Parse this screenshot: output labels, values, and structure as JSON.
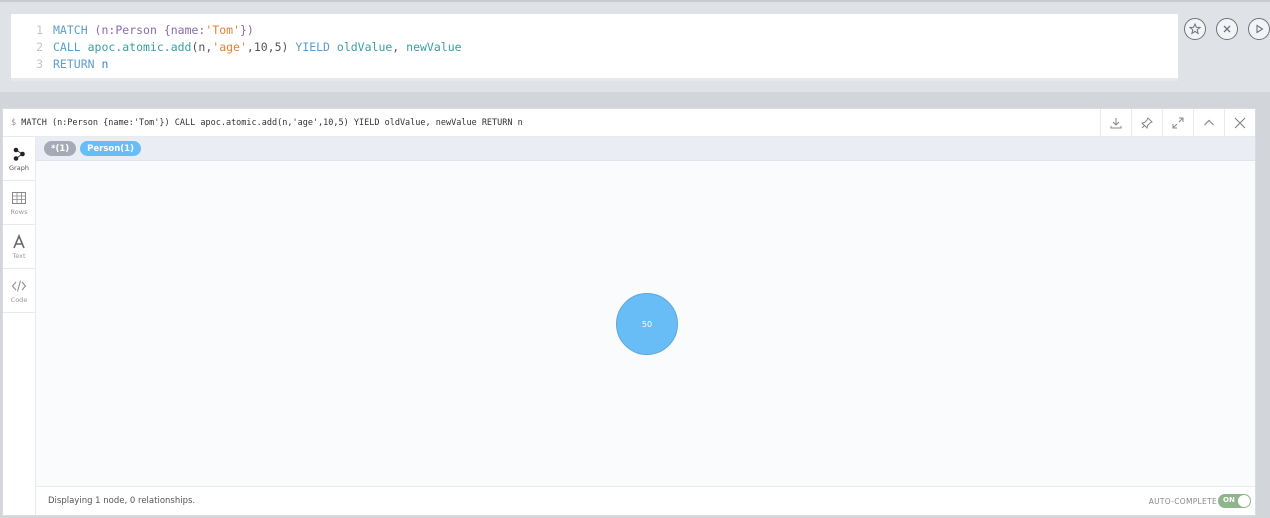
{
  "editor": {
    "lines": [
      {
        "num": "1",
        "tokens": [
          {
            "t": "MATCH ",
            "c": "kw"
          },
          {
            "t": "(",
            "c": "ph"
          },
          {
            "t": "n",
            "c": "ph"
          },
          {
            "t": ":Person ",
            "c": "ph"
          },
          {
            "t": "{name:",
            "c": "ph"
          },
          {
            "t": "'Tom'",
            "c": "str"
          },
          {
            "t": "})",
            "c": "ph"
          }
        ]
      },
      {
        "num": "2",
        "tokens": [
          {
            "t": "CALL ",
            "c": "kw"
          },
          {
            "t": "apoc.atomic.add",
            "c": "fn"
          },
          {
            "t": "(n,",
            "c": "pl"
          },
          {
            "t": "'age'",
            "c": "str"
          },
          {
            "t": ",10,5) ",
            "c": "pl"
          },
          {
            "t": "YIELD ",
            "c": "kw"
          },
          {
            "t": "oldValue",
            "c": "fn"
          },
          {
            "t": ", ",
            "c": "pl"
          },
          {
            "t": "newValue",
            "c": "fn"
          }
        ]
      },
      {
        "num": "3",
        "tokens": [
          {
            "t": "RETURN ",
            "c": "kw"
          },
          {
            "t": "n",
            "c": "var"
          }
        ]
      }
    ],
    "actions": [
      {
        "name": "favorite-star-button",
        "icon": "star-icon"
      },
      {
        "name": "clear-editor-button",
        "icon": "close-circle-icon"
      },
      {
        "name": "run-query-button",
        "icon": "play-icon"
      }
    ]
  },
  "frame": {
    "prompt": "$",
    "title": "MATCH (n:Person {name:'Tom'}) CALL apoc.atomic.add(n,'age',10,5) YIELD oldValue, newValue RETURN n",
    "tools": [
      {
        "name": "download-button",
        "icon": "download-icon"
      },
      {
        "name": "pin-button",
        "icon": "pin-icon"
      },
      {
        "name": "fullscreen-button",
        "icon": "expand-icon"
      },
      {
        "name": "collapse-button",
        "icon": "chevron-up-icon"
      },
      {
        "name": "close-frame-button",
        "icon": "close-icon"
      }
    ],
    "sidebar": [
      {
        "label": "Graph",
        "icon": "graph-icon",
        "active": true
      },
      {
        "label": "Rows",
        "icon": "table-icon",
        "active": false
      },
      {
        "label": "Text",
        "icon": "text-icon",
        "active": false
      },
      {
        "label": "Code",
        "icon": "code-icon",
        "active": false
      }
    ],
    "labels": [
      {
        "text": "*(1)",
        "kind": "all"
      },
      {
        "text": "Person(1)",
        "kind": "person"
      }
    ],
    "node": {
      "caption": "50",
      "color": "#68bdf6"
    },
    "status": "Displaying 1 node, 0 relationships.",
    "autocomplete_label": "AUTO-COMPLETE",
    "toggle_label": "ON"
  }
}
